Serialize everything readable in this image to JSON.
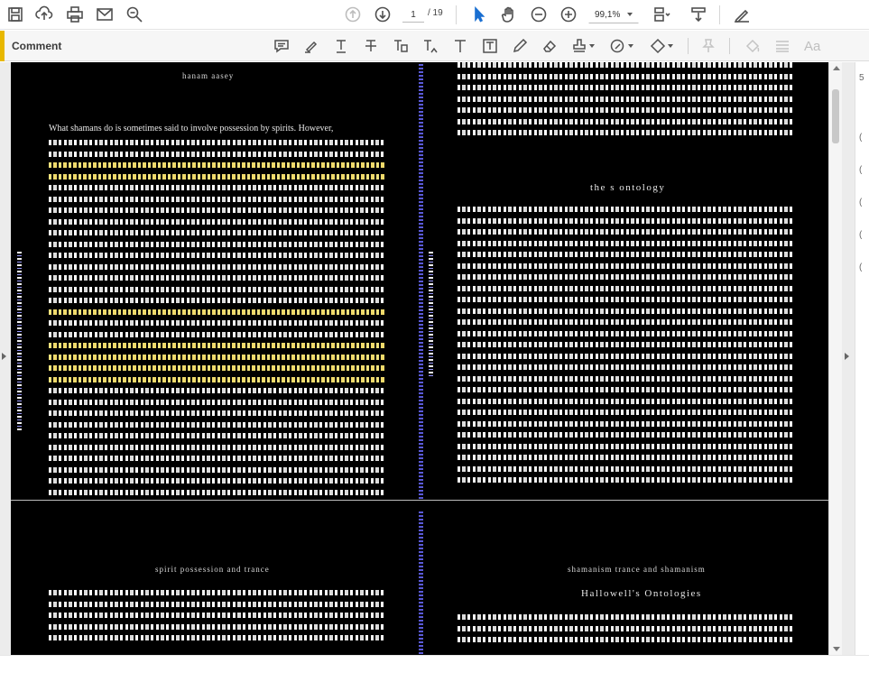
{
  "toolbar": {
    "page_current": "1",
    "page_total": "/ 19",
    "zoom": "99,1%",
    "icons": [
      "save-icon",
      "upload-icon",
      "print-icon",
      "email-icon",
      "find-icon",
      "prev-page-icon",
      "next-page-icon",
      "select-cursor-icon",
      "hand-icon",
      "zoom-out-icon",
      "zoom-in-icon",
      "page-layout-icon",
      "scroll-icon",
      "sign-icon"
    ]
  },
  "commentbar": {
    "label": "Comment",
    "aa_label": "Aa",
    "accent_color": "#e8b800",
    "icons": [
      "sticky-note-icon",
      "highlight-icon",
      "underline-text-icon",
      "strikethrough-text-icon",
      "replace-text-icon",
      "insert-text-icon",
      "add-text-icon",
      "text-box-icon",
      "pencil-icon",
      "eraser-icon",
      "stamp-icon",
      "attach-icon",
      "shapes-icon",
      "pin-icon",
      "fill-icon",
      "lines-icon"
    ]
  },
  "document": {
    "left_page": {
      "running_head": "hanam   aasey",
      "paragraph_intro": "What shamans do is sometimes said to involve possession by spirits. However,"
    },
    "right_page": {
      "section_heading": "the s ontology"
    },
    "left_page_2": {
      "running_head": "spirit possession and trance"
    },
    "right_page_2": {
      "running_head": "shamanism trance and shamanism",
      "section_heading": "Hallowell's Ontologies"
    }
  },
  "rightpanel": {
    "items": [
      "5",
      "(",
      "(",
      "(",
      "(",
      "("
    ]
  }
}
